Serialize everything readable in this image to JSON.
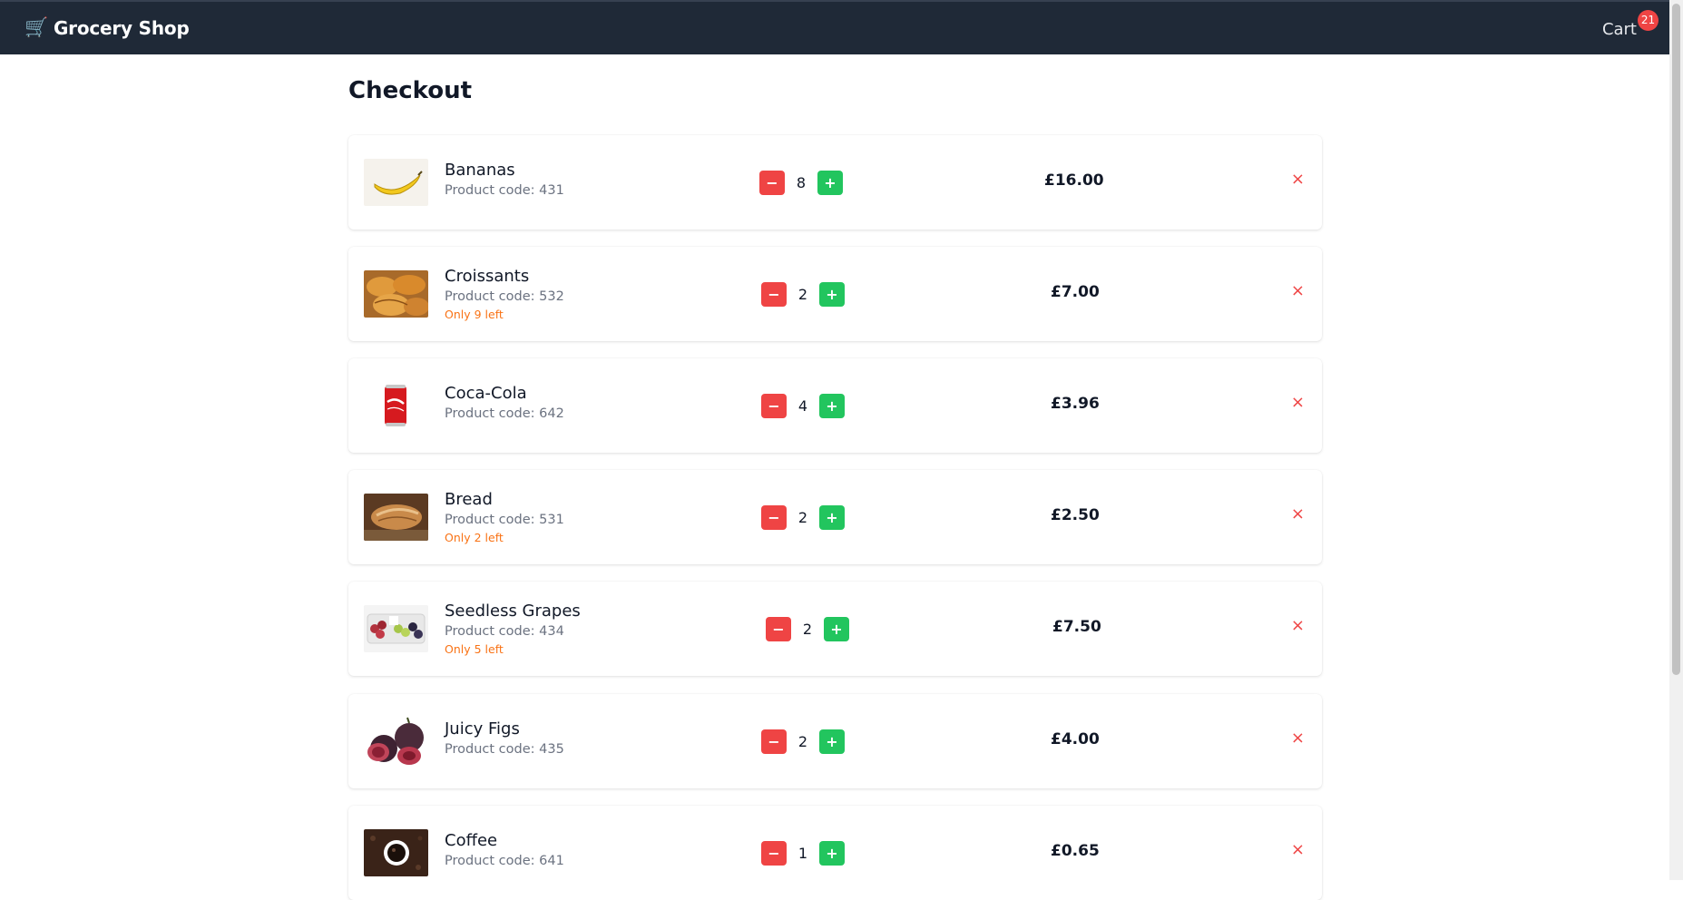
{
  "navbar": {
    "brand_icon": "🛒",
    "brand": "Grocery Shop",
    "cart_label": "Cart",
    "cart_count": "21"
  },
  "page": {
    "title": "Checkout"
  },
  "buttons": {
    "minus": "−",
    "plus": "+",
    "remove": "×"
  },
  "items": [
    {
      "name": "Bananas",
      "code": "Product code: 431",
      "stock": "",
      "qty": "8",
      "price": "£16.00",
      "thumb_icon": "banana-image"
    },
    {
      "name": "Croissants",
      "code": "Product code: 532",
      "stock": "Only 9 left",
      "qty": "2",
      "price": "£7.00",
      "thumb_icon": "croissant-image"
    },
    {
      "name": "Coca-Cola",
      "code": "Product code: 642",
      "stock": "",
      "qty": "4",
      "price": "£3.96",
      "thumb_icon": "cola-can-image"
    },
    {
      "name": "Bread",
      "code": "Product code: 531",
      "stock": "Only 2 left",
      "qty": "2",
      "price": "£2.50",
      "thumb_icon": "bread-image"
    },
    {
      "name": "Seedless Grapes",
      "code": "Product code: 434",
      "stock": "Only 5 left",
      "qty": "2",
      "price": "£7.50",
      "thumb_icon": "grapes-image"
    },
    {
      "name": "Juicy Figs",
      "code": "Product code: 435",
      "stock": "",
      "qty": "2",
      "price": "£4.00",
      "thumb_icon": "figs-image"
    },
    {
      "name": "Coffee",
      "code": "Product code: 641",
      "stock": "",
      "qty": "1",
      "price": "£0.65",
      "thumb_icon": "coffee-image"
    }
  ],
  "colors": {
    "navbar_bg": "#1f2937",
    "minus_button": "#ef4444",
    "plus_button": "#22c55e",
    "stock_warning": "#f97316",
    "remove": "#ef4444"
  }
}
